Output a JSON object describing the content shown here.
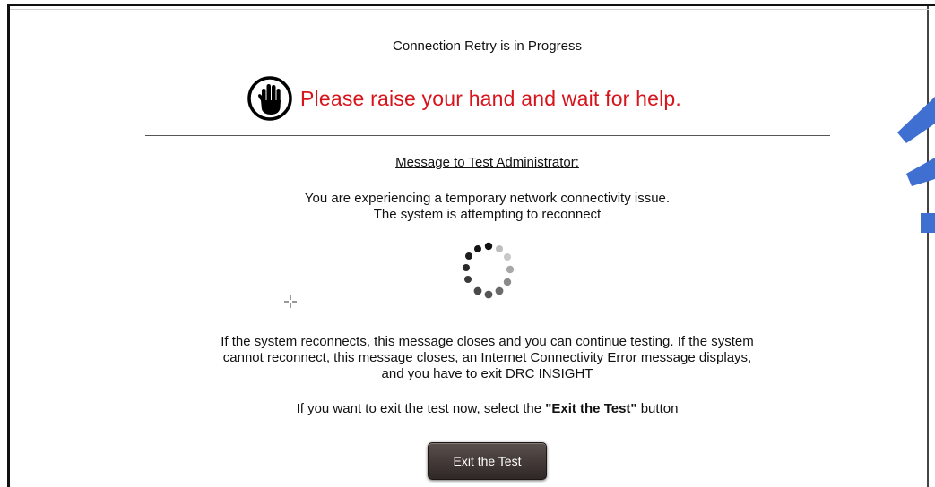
{
  "dialog": {
    "status_title": "Connection Retry is in Progress",
    "help_message": "Please raise your hand and wait for help.",
    "admin_heading": "Message to Test Administrator:",
    "issue_line1": "You are experiencing a temporary network connectivity issue.",
    "issue_line2": "The system is attempting to reconnect",
    "info_line1": "If the system reconnects, this message closes and you can continue testing. If the system",
    "info_line2": "cannot reconnect, this message closes, an Internet Connectivity Error message displays,",
    "info_line3": "and you have to exit DRC INSIGHT",
    "exit_prefix": "If you want to exit the test now, select the ",
    "exit_bold": "\"Exit the Test\"",
    "exit_suffix": " button",
    "exit_button_label": "Exit the Test"
  },
  "icons": {
    "hand": "raised-hand-icon",
    "spinner": "loading-spinner-icon",
    "cursor": "crosshair-cursor-icon"
  },
  "colors": {
    "help_text": "#d7141b",
    "button_bg": "#3f3633",
    "overlay_marks": "#3f6fd1"
  }
}
